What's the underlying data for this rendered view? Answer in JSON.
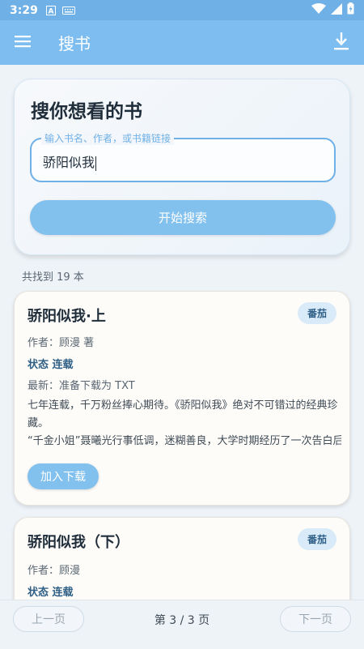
{
  "status_bar": {
    "time": "3:29"
  },
  "app_bar": {
    "title": "搜书"
  },
  "search": {
    "heading": "搜你想看的书",
    "placeholder": "输入书名、作者，或书籍链接",
    "value": "骄阳似我",
    "button_label": "开始搜索"
  },
  "results": {
    "count_text": "共找到 19 本",
    "items": [
      {
        "title": "骄阳似我·上",
        "source": "番茄",
        "author": "作者：顾漫 著",
        "status": "状态 连载",
        "latest": "最新：准备下载为 TXT",
        "desc_1": "七年连载，千万粉丝捧心期待。《骄阳似我》绝对不可错过的经典珍藏。",
        "desc_2": "“千金小姐”聂曦光行事低调，迷糊善良，大学时期经历了一次告白后",
        "add_label": "加入下载"
      },
      {
        "title": "骄阳似我（下）",
        "source": "番茄",
        "author": "作者：顾漫",
        "status": "状态 连载"
      }
    ]
  },
  "pagination": {
    "prev_label": "上一页",
    "page_info": "第 3 / 3 页",
    "next_label": "下一页"
  },
  "colors": {
    "app_bar": "#7dbdf0",
    "accent": "#82c0ee",
    "badge_bg": "#d9ebf8"
  }
}
